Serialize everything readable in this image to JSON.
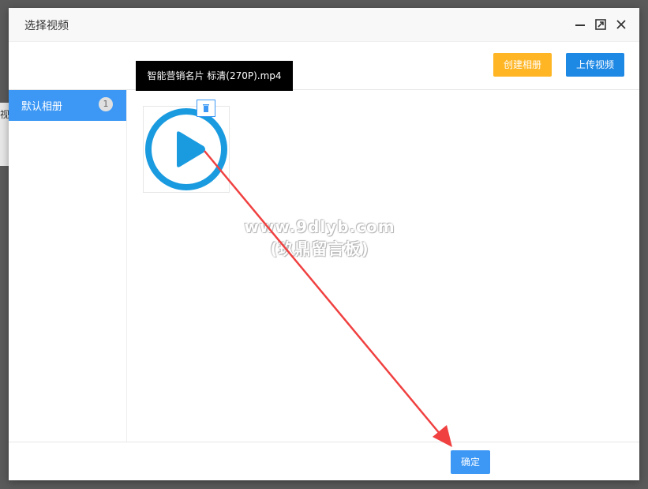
{
  "background": {
    "side_text": "视"
  },
  "dialog": {
    "title": "选择视频",
    "window_buttons": {
      "minimize_icon": "minimize-icon",
      "maximize_icon": "maximize-icon",
      "close_icon": "close-icon"
    }
  },
  "toolbar": {
    "create_album_label": "创建相册",
    "upload_video_label": "上传视频",
    "create_color": "#FFB524",
    "upload_color": "#1E88E5"
  },
  "sidebar": {
    "items": [
      {
        "label": "默认相册",
        "count": "1"
      }
    ]
  },
  "videos": [
    {
      "tooltip": "智能营销名片 标清(270P).mp4",
      "icon": "play-circle-icon"
    }
  ],
  "watermark": {
    "line1": "www.9dlyb.com",
    "line2": "(玖鼎留言板)"
  },
  "footer": {
    "confirm_label": "确定"
  },
  "colors": {
    "accent": "#3D98F5",
    "play": "#1A9BE0",
    "arrow": "#F04040"
  }
}
